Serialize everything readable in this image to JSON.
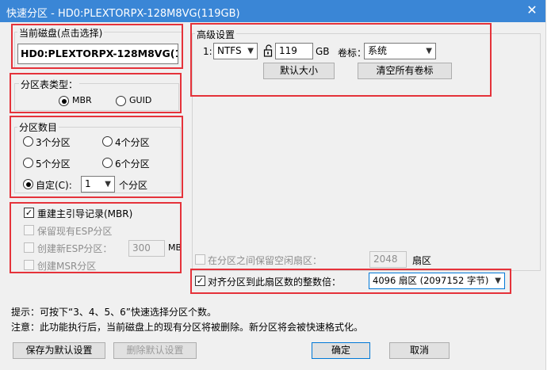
{
  "window": {
    "title": "快速分区 - HD0:PLEXTORPX-128M8VG(119GB)",
    "close_symbol": "✕"
  },
  "current_disk": {
    "label": "当前磁盘(点击选择)",
    "value": "HD0:PLEXTORPX-128M8VG(11"
  },
  "partition_table": {
    "label": "分区表类型：",
    "options": [
      "MBR",
      "GUID"
    ],
    "selected": "MBR"
  },
  "partition_count": {
    "label": "分区数目",
    "options": [
      "3个分区",
      "4个分区",
      "5个分区",
      "6个分区"
    ],
    "custom_label": "自定(C):",
    "custom_value": "1",
    "custom_suffix": "个分区",
    "selected": "custom"
  },
  "boot": {
    "rebuild_mbr": "重建主引导记录(MBR)",
    "keep_esp": "保留现有ESP分区",
    "create_esp": "创建新ESP分区：",
    "esp_size": "300",
    "esp_unit": "MB",
    "create_msr": "创建MSR分区"
  },
  "advanced": {
    "label": "高级设置",
    "row_index": "1:",
    "fs": "NTFS",
    "size": "119",
    "size_unit": "GB",
    "volume_label_caption": "卷标：",
    "volume_label": "系统",
    "default_size_button": "默认大小",
    "clear_labels_button": "清空所有卷标"
  },
  "reserve": {
    "label": "在分区之间保留空闲扇区：",
    "value": "2048",
    "unit": "扇区"
  },
  "align": {
    "label": "对齐分区到此扇区数的整数倍：",
    "value": "4096 扇区 (2097152 字节)"
  },
  "hints": {
    "tip": "提示：可按下“3、4、5、6”快速选择分区个数。",
    "note": "注意：此功能执行后，当前磁盘上的现有分区将被删除。新分区将会被快速格式化。"
  },
  "buttons": {
    "save_default": "保存为默认设置",
    "delete_default": "删除默认设置",
    "ok": "确定",
    "cancel": "取消"
  },
  "colors": {
    "title_bar": "#3a86d6",
    "highlight_border": "#e5323a",
    "dialog_bg": "#f0f0f0"
  }
}
